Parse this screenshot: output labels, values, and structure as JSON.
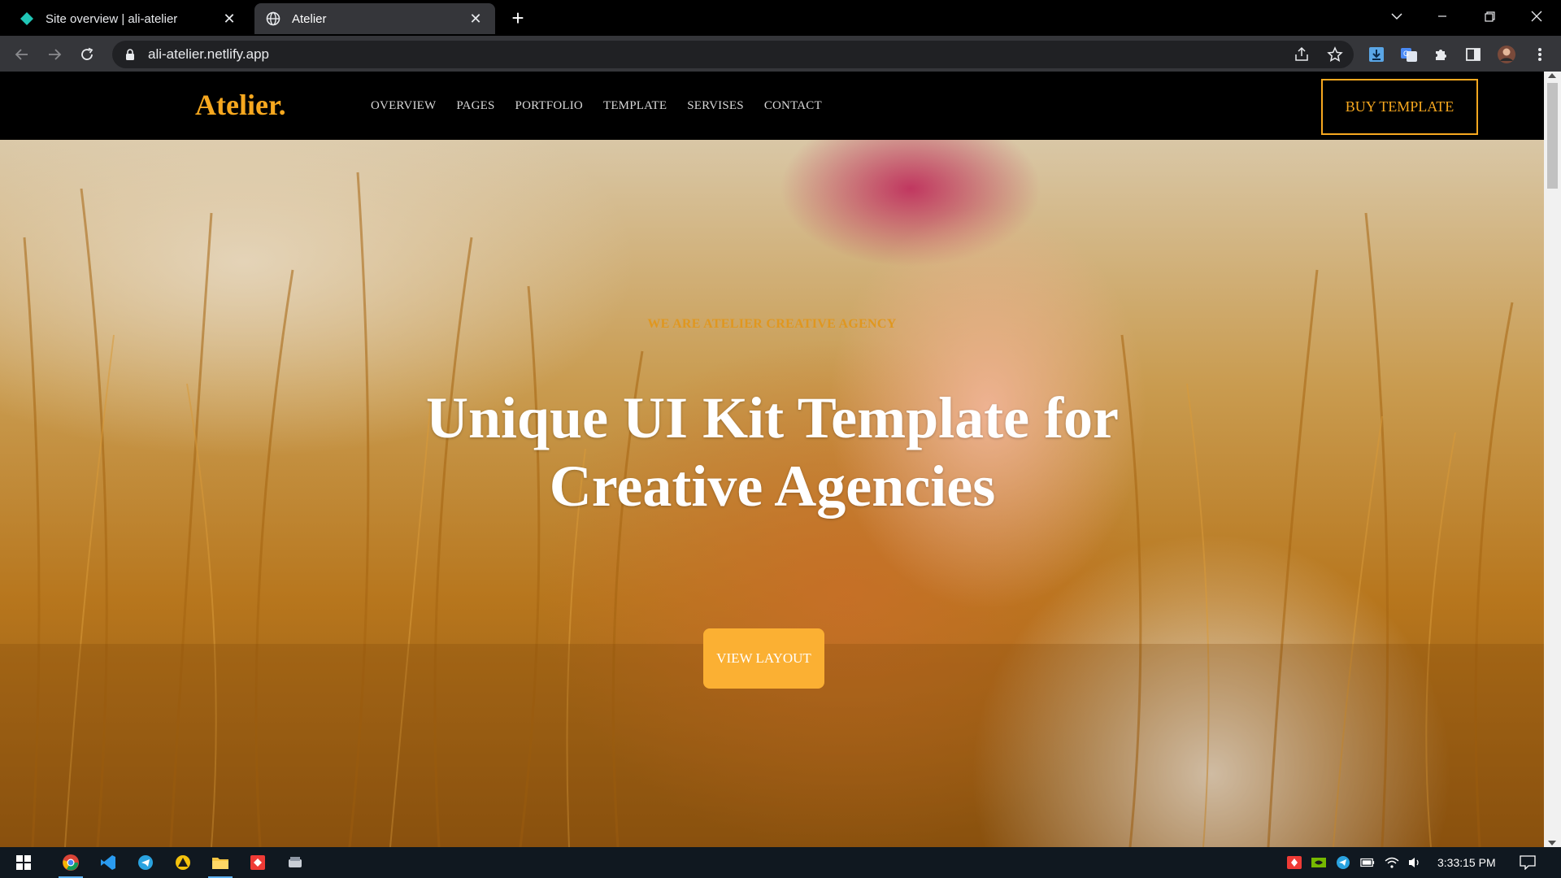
{
  "browser": {
    "tabs": [
      {
        "title": "Site overview | ali-atelier"
      },
      {
        "title": "Atelier"
      }
    ],
    "url": "ali-atelier.netlify.app"
  },
  "site": {
    "logo": "Atelier.",
    "nav": [
      "OVERVIEW",
      "PAGES",
      "PORTFOLIO",
      "TEMPLATE",
      "SERVISES",
      "CONTACT"
    ],
    "cta": "BUY TEMPLATE",
    "hero": {
      "tagline": "WE ARE ATELIER CREATIVE AGENCY",
      "headline": "Unique UI Kit Template for Creative Agencies",
      "button": "VIEW LAYOUT"
    }
  },
  "taskbar": {
    "clock": "3:33:15 PM"
  },
  "colors": {
    "accent": "#f7a81f",
    "button_fill": "#fbb033",
    "header_bg": "#000000",
    "chrome_toolbar": "#35363a"
  }
}
